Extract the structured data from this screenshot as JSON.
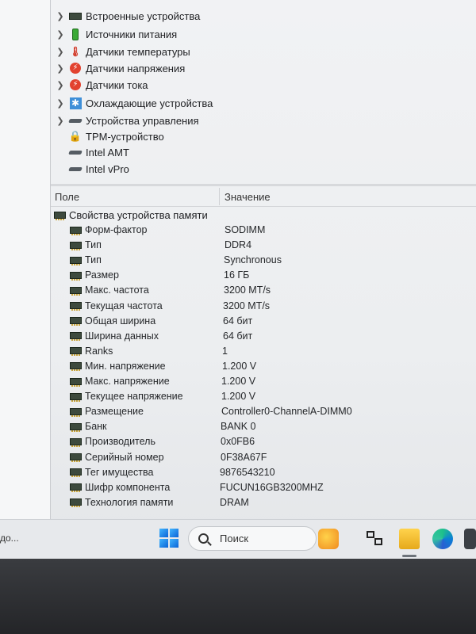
{
  "tree": {
    "items": [
      {
        "label": "Встроенные устройства",
        "icon": "chip-icon",
        "expandable": true
      },
      {
        "label": "Источники питания",
        "icon": "battery-icon",
        "expandable": true
      },
      {
        "label": "Датчики температуры",
        "icon": "thermometer-icon",
        "expandable": true
      },
      {
        "label": "Датчики напряжения",
        "icon": "voltage-sensor-icon",
        "expandable": true
      },
      {
        "label": "Датчики тока",
        "icon": "current-sensor-icon",
        "expandable": true
      },
      {
        "label": "Охлаждающие устройства",
        "icon": "fan-icon",
        "expandable": true
      },
      {
        "label": "Устройства управления",
        "icon": "cable-icon",
        "expandable": true
      },
      {
        "label": "TPM-устройство",
        "icon": "lock-icon",
        "expandable": false
      },
      {
        "label": "Intel AMT",
        "icon": "cable-icon",
        "expandable": false
      },
      {
        "label": "Intel vPro",
        "icon": "cable-icon",
        "expandable": false
      }
    ]
  },
  "grid": {
    "col_field": "Поле",
    "col_value": "Значение",
    "group_label": "Свойства устройства памяти",
    "rows": [
      {
        "name": "Форм-фактор",
        "value": "SODIMM"
      },
      {
        "name": "Тип",
        "value": "DDR4"
      },
      {
        "name": "Тип",
        "value": "Synchronous"
      },
      {
        "name": "Размер",
        "value": "16 ГБ"
      },
      {
        "name": "Макс. частота",
        "value": "3200 MT/s"
      },
      {
        "name": "Текущая частота",
        "value": "3200 MT/s"
      },
      {
        "name": "Общая ширина",
        "value": "64 бит"
      },
      {
        "name": "Ширина данных",
        "value": "64 бит"
      },
      {
        "name": "Ranks",
        "value": "1"
      },
      {
        "name": "Мин. напряжение",
        "value": "1.200 V"
      },
      {
        "name": "Макс. напряжение",
        "value": "1.200 V"
      },
      {
        "name": "Текущее напряжение",
        "value": "1.200 V"
      },
      {
        "name": "Размещение",
        "value": "Controller0-ChannelA-DIMM0"
      },
      {
        "name": "Банк",
        "value": "BANK 0"
      },
      {
        "name": "Производитель",
        "value": "0x0FB6"
      },
      {
        "name": "Серийный номер",
        "value": "0F38A67F"
      },
      {
        "name": "Тег имущества",
        "value": "9876543210"
      },
      {
        "name": "Шифр компонента",
        "value": "FUCUN16GB3200MHZ"
      },
      {
        "name": "Технология памяти",
        "value": "DRAM"
      }
    ]
  },
  "taskbar": {
    "left_text": "до...",
    "search_placeholder": "Поиск",
    "apps": [
      "widgets-icon",
      "task-view-icon",
      "file-explorer-icon",
      "edge-icon",
      "store-icon"
    ]
  }
}
